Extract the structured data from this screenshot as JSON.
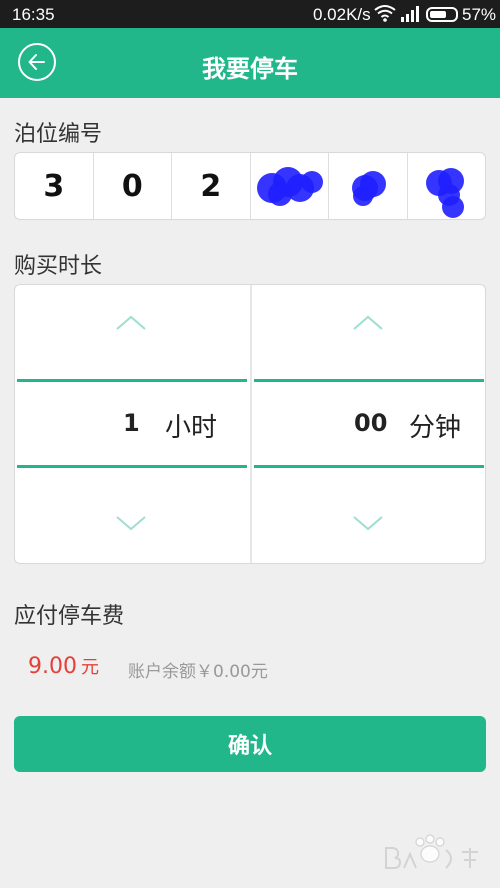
{
  "status_bar": {
    "time": "16:35",
    "network_speed": "0.02K/s",
    "battery_percent": "57%"
  },
  "header": {
    "title": "我要停车",
    "back_icon": "back-arrow-circle-icon"
  },
  "berth": {
    "label": "泊位编号",
    "digits": [
      "3",
      "0",
      "2",
      "",
      "",
      ""
    ],
    "note_obscured_cells": 3
  },
  "duration": {
    "label": "购买时长",
    "hours_value": "1",
    "hours_unit": "小时",
    "minutes_value": "00",
    "minutes_unit": "分钟"
  },
  "fee": {
    "label": "应付停车费",
    "amount": "9.00",
    "currency_unit": "元",
    "balance_text": "账户余额￥0.00元"
  },
  "confirm": {
    "label": "确认"
  },
  "colors": {
    "brand": "#22b68b",
    "price": "#e2413a",
    "scribble": "#1f1fff"
  }
}
